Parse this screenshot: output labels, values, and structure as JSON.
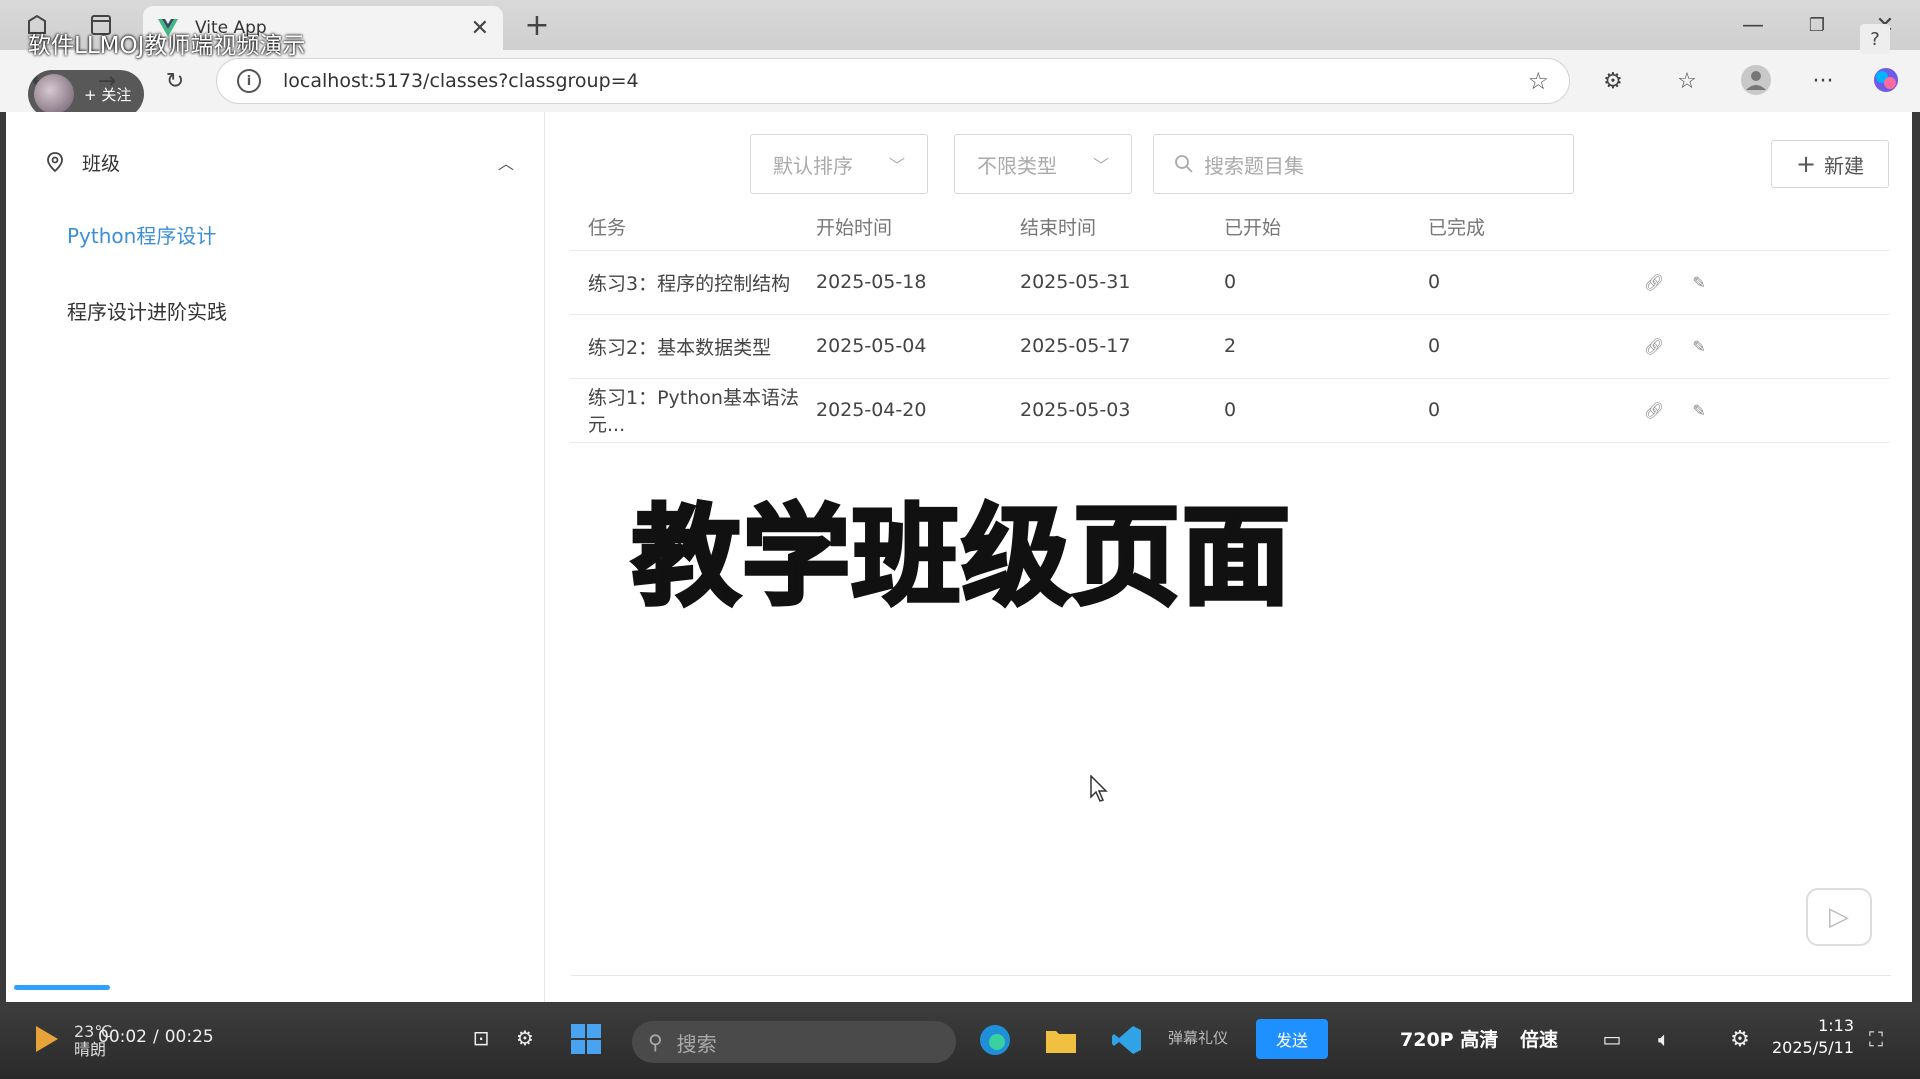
{
  "browser": {
    "tab_title": "Vite App",
    "url": "localhost:5173/classes?classgroup=4",
    "new_tab": "+"
  },
  "overlay": {
    "video_title": "软件LLMOJ教师端视频演示",
    "follow_label": "+ 关注"
  },
  "sidebar": {
    "group_label": "班级",
    "items": [
      {
        "label": "Python程序设计",
        "active": true
      },
      {
        "label": "程序设计进阶实践",
        "active": false
      }
    ]
  },
  "filters": {
    "sort_placeholder": "默认排序",
    "type_placeholder": "不限类型",
    "search_placeholder": "搜索题目集",
    "new_label": "新建"
  },
  "table": {
    "headers": [
      "任务",
      "开始时间",
      "结束时间",
      "已开始",
      "已完成"
    ],
    "rows": [
      {
        "task": "练习3：程序的控制结构",
        "start": "2025-05-18",
        "end": "2025-05-31",
        "started": "0",
        "done": "0"
      },
      {
        "task": "练习2：基本数据类型",
        "start": "2025-05-04",
        "end": "2025-05-17",
        "started": "2",
        "done": "0"
      },
      {
        "task": "练习1：Python基本语法元...",
        "start": "2025-04-20",
        "end": "2025-05-03",
        "started": "0",
        "done": "0"
      }
    ]
  },
  "caption": "教学班级页面",
  "player": {
    "weather_temp": "23℃",
    "weather_desc": "晴朗",
    "current_time": "00:02",
    "separator": "/",
    "duration": "00:25",
    "taskbar_search": "搜索",
    "danmaku": "弹幕礼仪",
    "send": "发送",
    "quality": "720P 高清",
    "speed": "倍速",
    "clock_time": "1:13",
    "clock_date": "2025/5/11",
    "progress_fraction": 0.08
  }
}
